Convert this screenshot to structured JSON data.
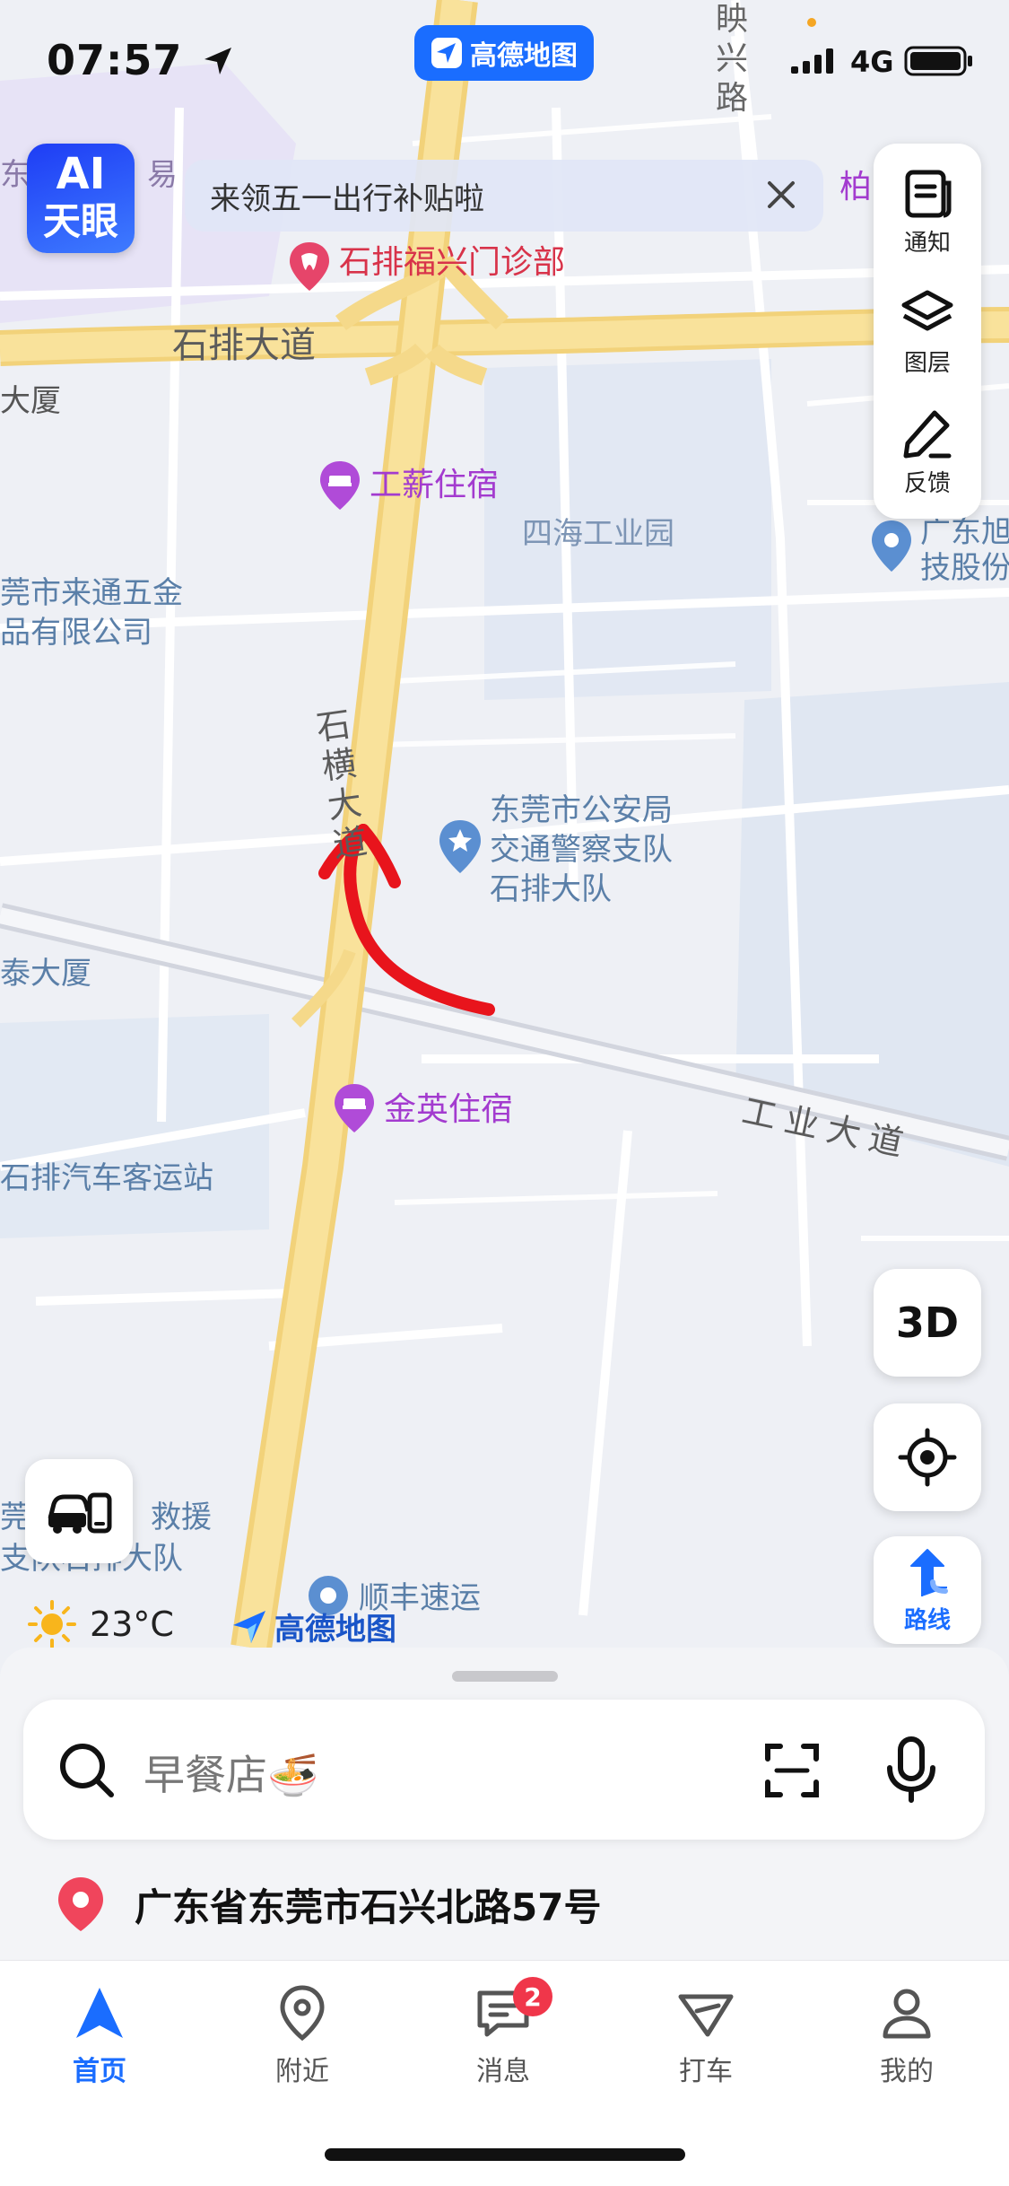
{
  "status_bar": {
    "time": "07:57",
    "app_badge": "高德地图",
    "network": "4G"
  },
  "ai_eye": {
    "line1": "AI",
    "line2": "天眼"
  },
  "banner": {
    "text": "来领五一出行补贴啦"
  },
  "tools": [
    {
      "label": "通知",
      "icon": "notification-icon"
    },
    {
      "label": "图层",
      "icon": "layers-icon"
    },
    {
      "label": "反馈",
      "icon": "feedback-icon"
    }
  ],
  "map": {
    "labels": {
      "clinic": "石排福兴门诊部",
      "road_shipai": "石排大道",
      "dasha": "大厦",
      "gongxin": "工薪住宿",
      "sihai": "四海工业园",
      "laitong_1": "莞市来通五金",
      "laitong_2": "品有限公司",
      "guangdong_1": "广东旭",
      "guangdong_2": "技股份",
      "shiheng": "石横大道",
      "police_1": "东莞市公安局",
      "police_2": "交通警察支队",
      "police_3": "石排大队",
      "tai": "泰大厦",
      "jinying": "金英住宿",
      "gongye": "工业大道",
      "bus_station": "石排汽车客运站",
      "rescue_1": "莞",
      "rescue_1b": "救援",
      "rescue_2": "支队石排大队",
      "shunfeng": "顺丰速运",
      "yixing": "眏兴路",
      "bo": "柏",
      "yi": "易",
      "dong": "东"
    }
  },
  "map_buttons": {
    "three_d": "3D",
    "route": "路线"
  },
  "weather": {
    "temp": "23°C"
  },
  "map_logo": "高德地图",
  "search": {
    "placeholder": "早餐店🍜"
  },
  "address": "广东省东莞市石兴北路57号",
  "tabs": [
    {
      "label": "首页",
      "icon": "navigation-arrow-icon",
      "active": true
    },
    {
      "label": "附近",
      "icon": "location-pin-icon"
    },
    {
      "label": "消息",
      "icon": "message-icon",
      "badge": "2"
    },
    {
      "label": "打车",
      "icon": "taxi-icon"
    },
    {
      "label": "我的",
      "icon": "user-icon"
    }
  ],
  "colors": {
    "accent": "#1a6dff",
    "road_main": "#f7dc8a",
    "annotation": "#e8141c"
  }
}
